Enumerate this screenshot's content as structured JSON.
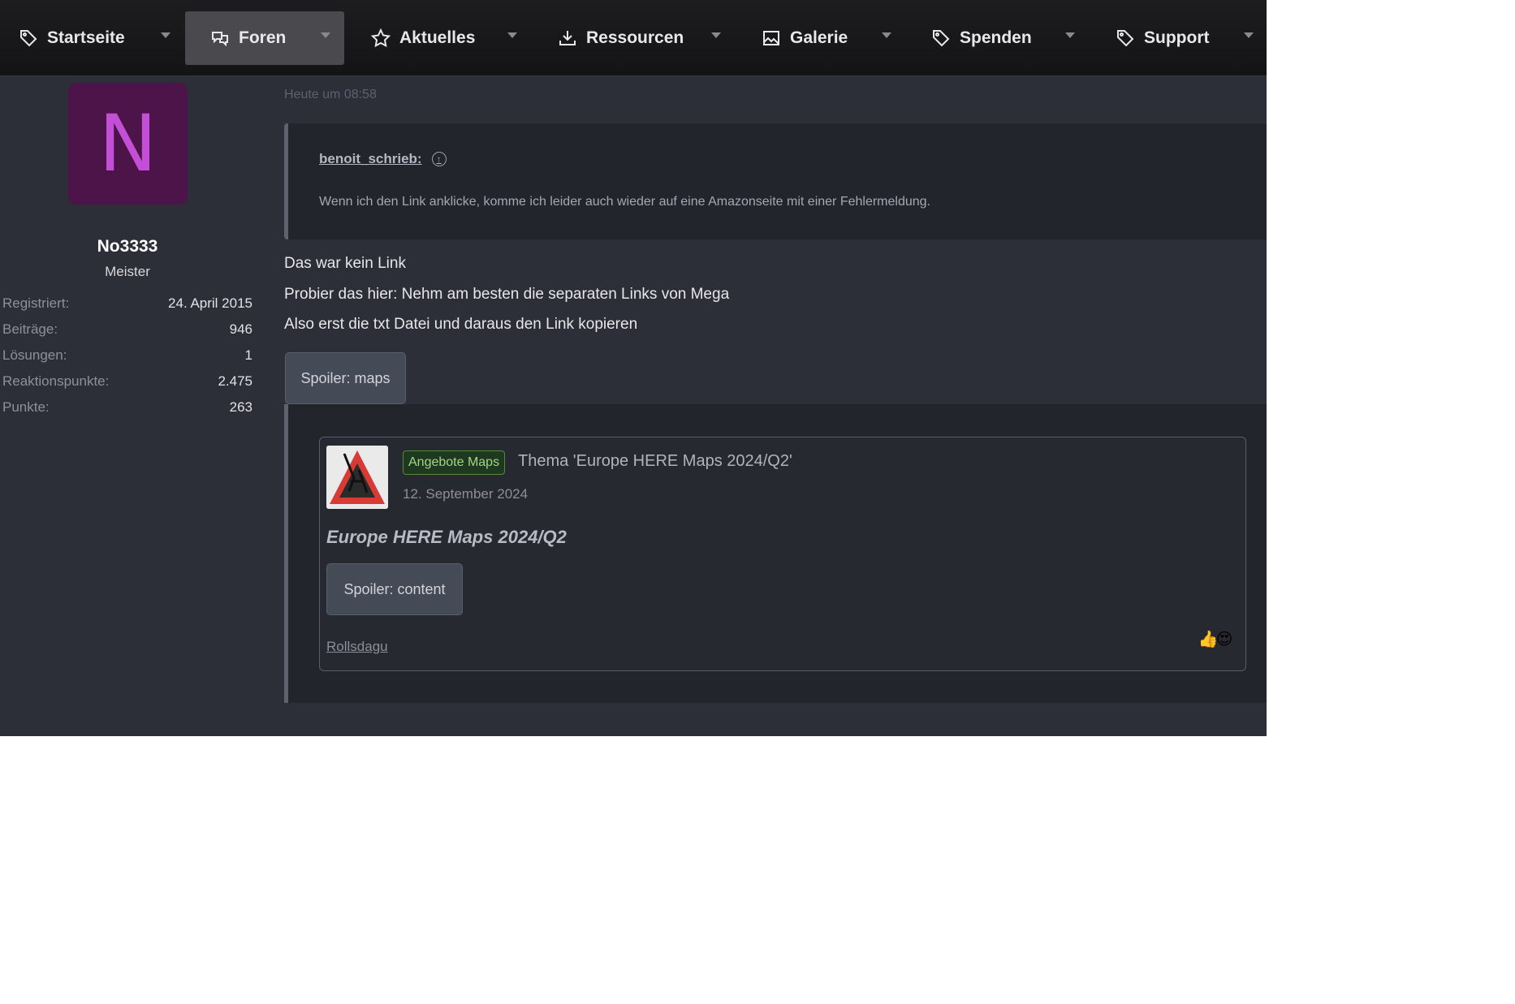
{
  "nav": {
    "items": [
      {
        "label": "Startseite",
        "icon": "tag-icon"
      },
      {
        "label": "Foren",
        "icon": "chat-bubbles-icon",
        "active": true
      },
      {
        "label": "Aktuelles",
        "icon": "star-icon"
      },
      {
        "label": "Ressourcen",
        "icon": "download-tray-icon"
      },
      {
        "label": "Galerie",
        "icon": "image-icon"
      },
      {
        "label": "Spenden",
        "icon": "tag-icon"
      },
      {
        "label": "Support",
        "icon": "tag-icon"
      }
    ]
  },
  "user": {
    "avatar_letter": "N",
    "avatar_color": "#4c1448",
    "name": "No3333",
    "title": "Meister",
    "stats": [
      {
        "key": "Registriert:",
        "value": "24. April 2015"
      },
      {
        "key": "Beiträge:",
        "value": "946"
      },
      {
        "key": "Lösungen:",
        "value": "1"
      },
      {
        "key": "Reaktionspunkte:",
        "value": "2.475"
      },
      {
        "key": "Punkte:",
        "value": "263"
      }
    ]
  },
  "post": {
    "timestamp": "Heute um 08:58",
    "quote": {
      "author": "benoit_schrieb:",
      "text": "Wenn ich den Link anklicke, komme ich leider auch wieder auf eine Amazonseite mit einer Fehlermeldung."
    },
    "lines": [
      "Das war kein Link",
      "Probier das hier: Nehm am besten die separaten Links von Mega",
      "Also erst die txt Datei und daraus den Link kopieren"
    ],
    "spoiler_label": "Spoiler: maps",
    "embed": {
      "prefix": "Angebote Maps",
      "title": "Thema 'Europe HERE Maps 2024/Q2'",
      "date": "12. September 2024",
      "heading": "Europe HERE Maps 2024/Q2",
      "spoiler_label": "Spoiler: content",
      "author": "Rollsdagu",
      "reactions": [
        "👍",
        "😍"
      ]
    }
  }
}
